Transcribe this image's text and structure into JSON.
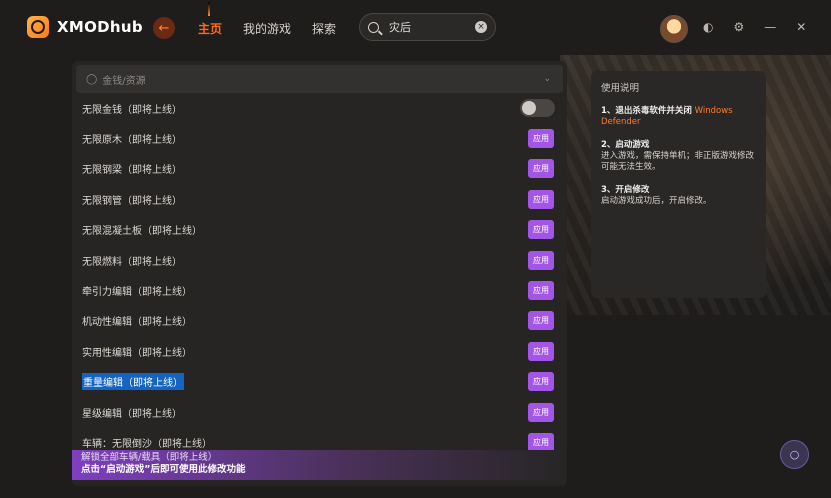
{
  "app": {
    "name": "XMODhub"
  },
  "nav": {
    "home": "主页",
    "my_games": "我的游戏",
    "explore": "探索"
  },
  "search": {
    "value": "灾后"
  },
  "panel": {
    "section_title": "金钱/资源",
    "rows": [
      {
        "label": "无限金钱（即将上线）",
        "control": "toggle"
      },
      {
        "label": "无限原木（即将上线）",
        "control": "apply"
      },
      {
        "label": "无限钢梁（即将上线）",
        "control": "apply"
      },
      {
        "label": "无限钢管（即将上线）",
        "control": "apply"
      },
      {
        "label": "无限混凝土板（即将上线）",
        "control": "apply"
      },
      {
        "label": "无限燃料（即将上线）",
        "control": "apply"
      },
      {
        "label": "牵引力编辑（即将上线）",
        "control": "apply"
      },
      {
        "label": "机动性编辑（即将上线）",
        "control": "apply"
      },
      {
        "label": "实用性编辑（即将上线）",
        "control": "apply"
      },
      {
        "label": "重量编辑（即将上线）",
        "control": "apply",
        "selected": true
      },
      {
        "label": "星级编辑（即将上线）",
        "control": "apply"
      },
      {
        "label": "车辆：无限倒沙（即将上线）",
        "control": "apply"
      }
    ],
    "apply_label": "应用",
    "banner_line1": "解锁全部车辆/载具（即将上线）",
    "banner_line2": "点击“启动游戏”后即可使用此修改功能"
  },
  "info": {
    "title": "使用说明",
    "step1_title": "1、退出杀毒软件并关闭",
    "step1_highlight": "Windows Defender",
    "step2_title": "2、启动游戏",
    "step2_text": "进入游戏，需保持单机；非正版游戏修改可能无法生效。",
    "step3_title": "3、开启修改",
    "step3_text": "启动游戏成功后，开启修改。"
  },
  "colors": {
    "accent": "#ff6a1a",
    "apply_button": "#a356e6",
    "selection": "#1565c0"
  },
  "icons": [
    "logo-icon",
    "back-arrow-icon",
    "search-icon",
    "clear-icon",
    "avatar",
    "theme-icon",
    "settings-icon",
    "minimize-icon",
    "close-icon",
    "mouse-icon",
    "chevron-down-icon",
    "headset-icon"
  ]
}
